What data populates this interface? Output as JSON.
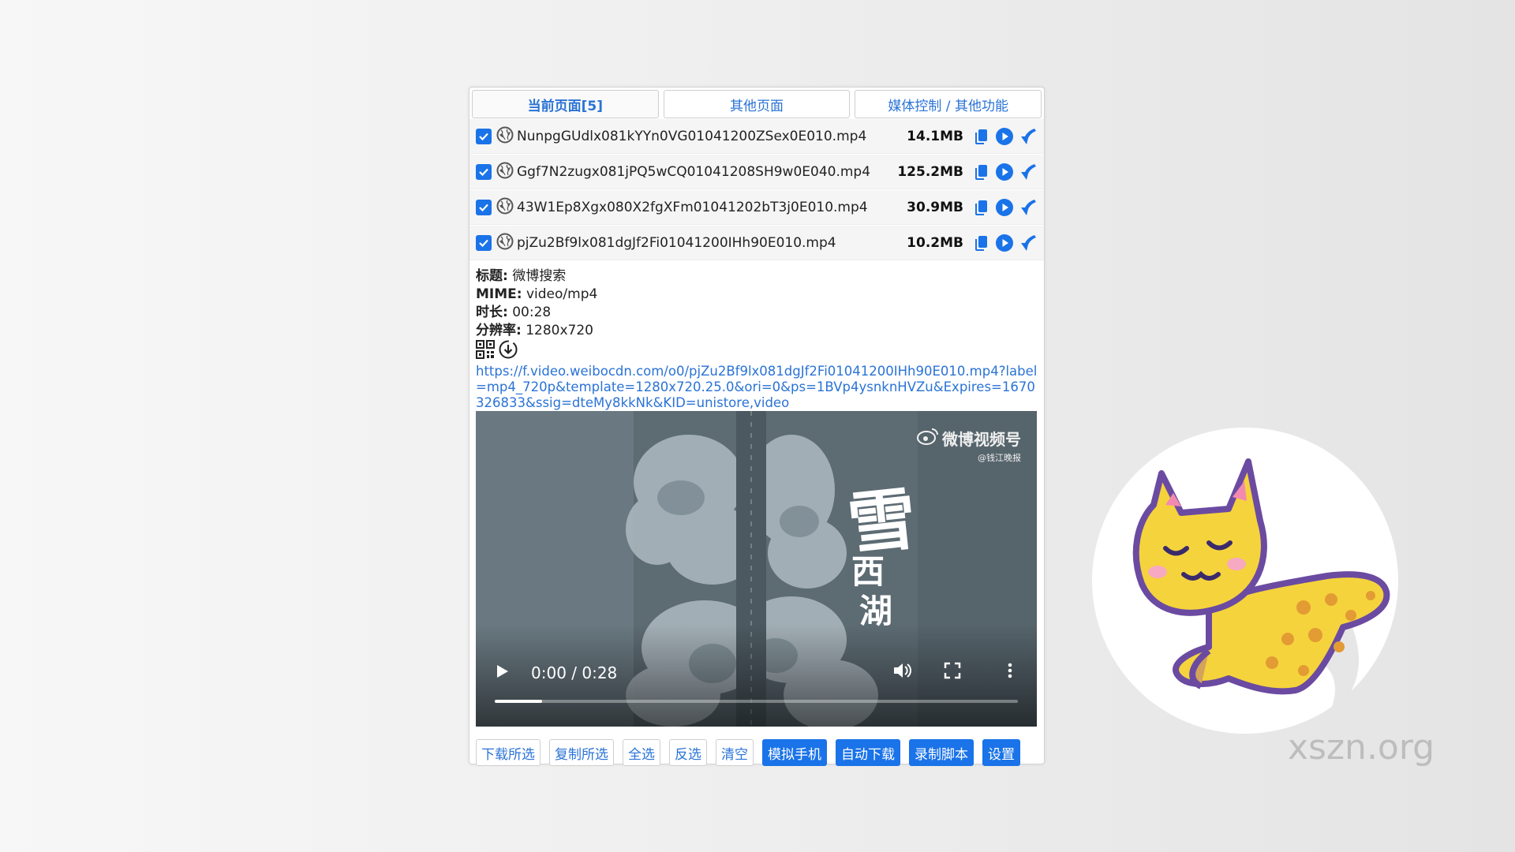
{
  "tabs": [
    {
      "label": "当前页面[5]",
      "active": true
    },
    {
      "label": "其他页面",
      "active": false
    },
    {
      "label": "媒体控制 / 其他功能",
      "active": false
    }
  ],
  "files": [
    {
      "name": "NunpgGUdlx081kYYn0VG01041200ZSex0E010.mp4",
      "size": "14.1MB",
      "checked": true
    },
    {
      "name": "Ggf7N2zugx081jPQ5wCQ01041208SH9w0E040.mp4",
      "size": "125.2MB",
      "checked": true
    },
    {
      "name": "43W1Ep8Xgx080X2fgXFm01041202bT3j0E010.mp4",
      "size": "30.9MB",
      "checked": true
    },
    {
      "name": "pjZu2Bf9lx081dgJf2Fi01041200IHh90E010.mp4",
      "size": "10.2MB",
      "checked": true
    }
  ],
  "info": {
    "title_label": "标题:",
    "title_value": "微博搜索",
    "mime_label": "MIME:",
    "mime_value": "video/mp4",
    "duration_label": "时长:",
    "duration_value": "00:28",
    "resolution_label": "分辨率:",
    "resolution_value": "1280x720",
    "url": "https://f.video.weibocdn.com/o0/pjZu2Bf9lx081dgJf2Fi01041200IHh90E010.mp4?label=mp4_720p&template=1280x720.25.0&ori=0&ps=1BVp4ysnknHVZu&Expires=1670326833&ssig=dteMy8kkNk&KID=unistore,video"
  },
  "video": {
    "watermark_main": "微博视频号",
    "watermark_sub": "@钱江晚报",
    "title_line1": "雪",
    "title_line2": "西",
    "title_line3": "湖",
    "time": "0:00 / 0:28",
    "progress_fraction": 0.09
  },
  "buttons": [
    {
      "label": "下载所选",
      "primary": false
    },
    {
      "label": "复制所选",
      "primary": false
    },
    {
      "label": "全选",
      "primary": false
    },
    {
      "label": "反选",
      "primary": false
    },
    {
      "label": "清空",
      "primary": false
    },
    {
      "label": "模拟手机",
      "primary": true
    },
    {
      "label": "自动下载",
      "primary": true
    },
    {
      "label": "录制脚本",
      "primary": true
    },
    {
      "label": "设置",
      "primary": true
    }
  ],
  "watermark_site": "xszn.org",
  "colors": {
    "accent": "#1a73e8",
    "link": "#2a73d6"
  }
}
